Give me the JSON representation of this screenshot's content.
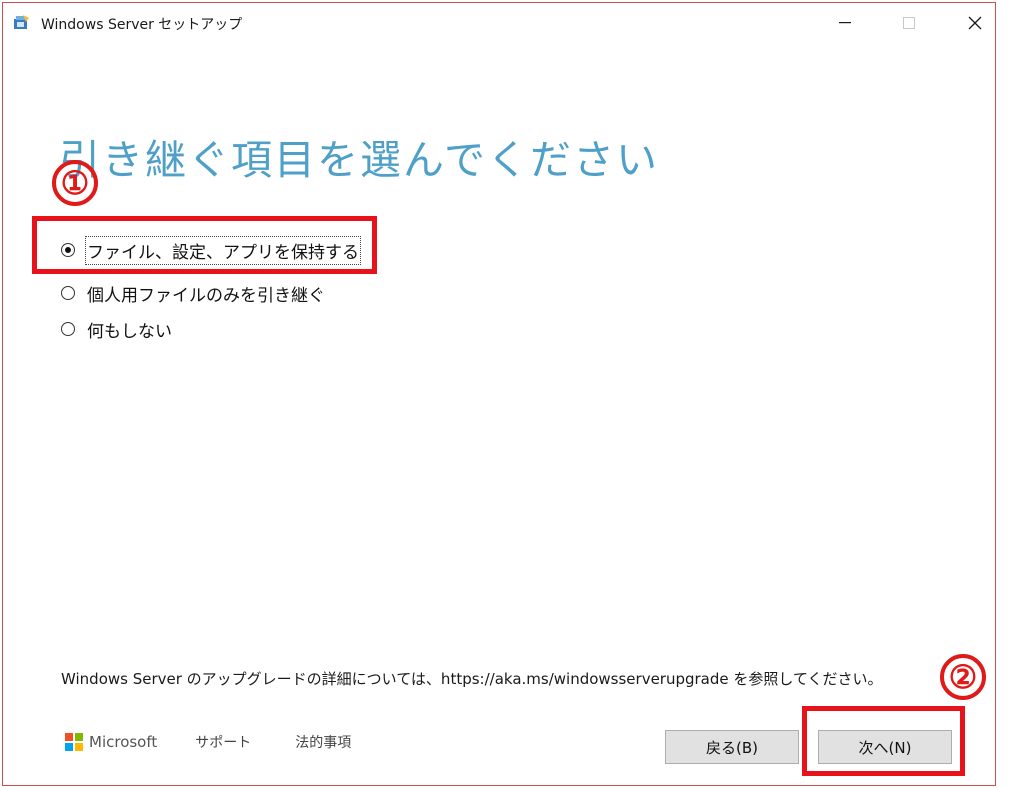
{
  "window": {
    "title": "Windows Server セットアップ",
    "controls": {
      "minimize": "—",
      "maximize": "☐",
      "close": "✕"
    }
  },
  "page": {
    "heading": "引き継ぐ項目を選んでください",
    "options": [
      {
        "label": "ファイル、設定、アプリを保持する",
        "selected": true
      },
      {
        "label": "個人用ファイルのみを引き継ぐ",
        "selected": false
      },
      {
        "label": "何もしない",
        "selected": false
      }
    ],
    "info_text": "Windows Server のアップグレードの詳細については、https://aka.ms/windowsserverupgrade を参照してください。"
  },
  "annotations": {
    "step1": "①",
    "step2": "②",
    "highlight_color": "#e8121b"
  },
  "footer": {
    "brand": "Microsoft",
    "support_link": "サポート",
    "legal_link": "法的事項",
    "logo_colors": [
      "#f25022",
      "#7fba00",
      "#00a4ef",
      "#ffb900"
    ]
  },
  "buttons": {
    "back": "戻る(B)",
    "next": "次へ(N)"
  },
  "colors": {
    "heading": "#4fa0c9",
    "window_border": "#c9504f"
  }
}
